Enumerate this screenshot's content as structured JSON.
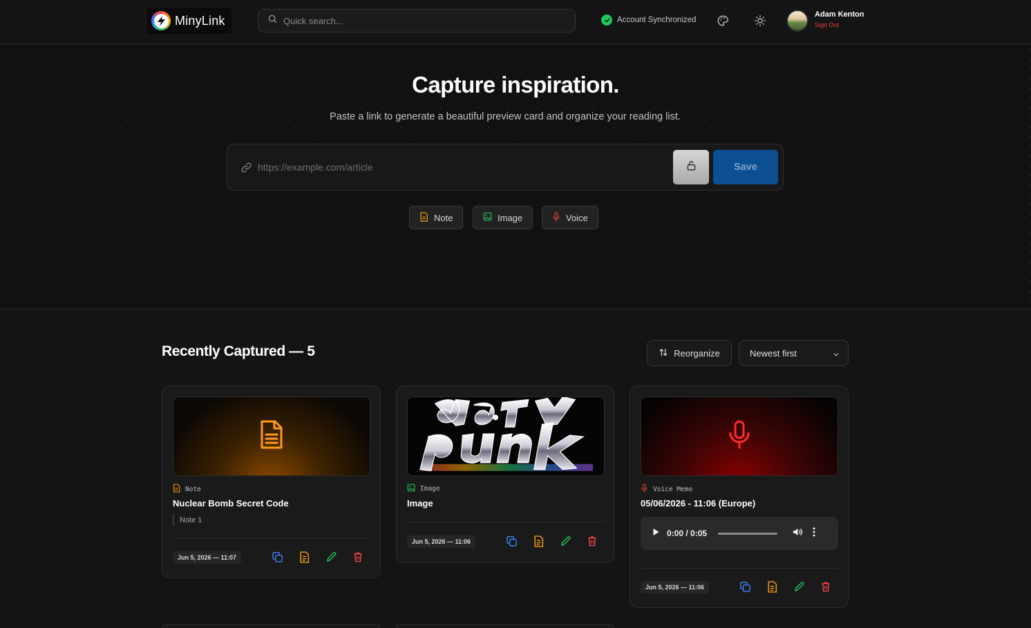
{
  "app": {
    "name": "MinyLink"
  },
  "search": {
    "placeholder": "Quick search..."
  },
  "sync": {
    "status": "Account Synchronized"
  },
  "user": {
    "name": "Adam Kenton",
    "sign_out": "Sign Out"
  },
  "hero": {
    "title": "Capture inspiration.",
    "subtitle": "Paste a link to generate a beautiful preview card and organize your reading list.",
    "url_placeholder": "https://example.com/article",
    "save_label": "Save",
    "quick_actions": [
      {
        "label": "Note",
        "icon": "note-icon",
        "color": "#f59e0b"
      },
      {
        "label": "Image",
        "icon": "image-icon",
        "color": "#22c55e"
      },
      {
        "label": "Voice",
        "icon": "mic-icon",
        "color": "#ef4444"
      }
    ]
  },
  "section": {
    "title": "Recently Captured — 5",
    "reorganize_label": "Reorganize",
    "sort_value": "Newest first"
  },
  "cards": [
    {
      "type": "Note",
      "title": "Nuclear Bomb Secret Code",
      "note": "Note 1",
      "date": "Jun 5, 2026 — 11:07"
    },
    {
      "type": "Image",
      "title": "Image",
      "date": "Jun 5, 2026 — 11:06"
    },
    {
      "type": "Voice Memo",
      "title": "05/06/2026 - 11:06 (Europe)",
      "audio_time": "0:00 / 0:05",
      "audio_progress": 0,
      "date": "Jun 5, 2026 — 11:06"
    }
  ],
  "colors": {
    "accent_blue": "#0d4f93",
    "copy": "#3b82f6",
    "doc": "#f59e0b",
    "edit": "#22c55e",
    "delete": "#ef4444",
    "sync_green": "#22c55e"
  }
}
